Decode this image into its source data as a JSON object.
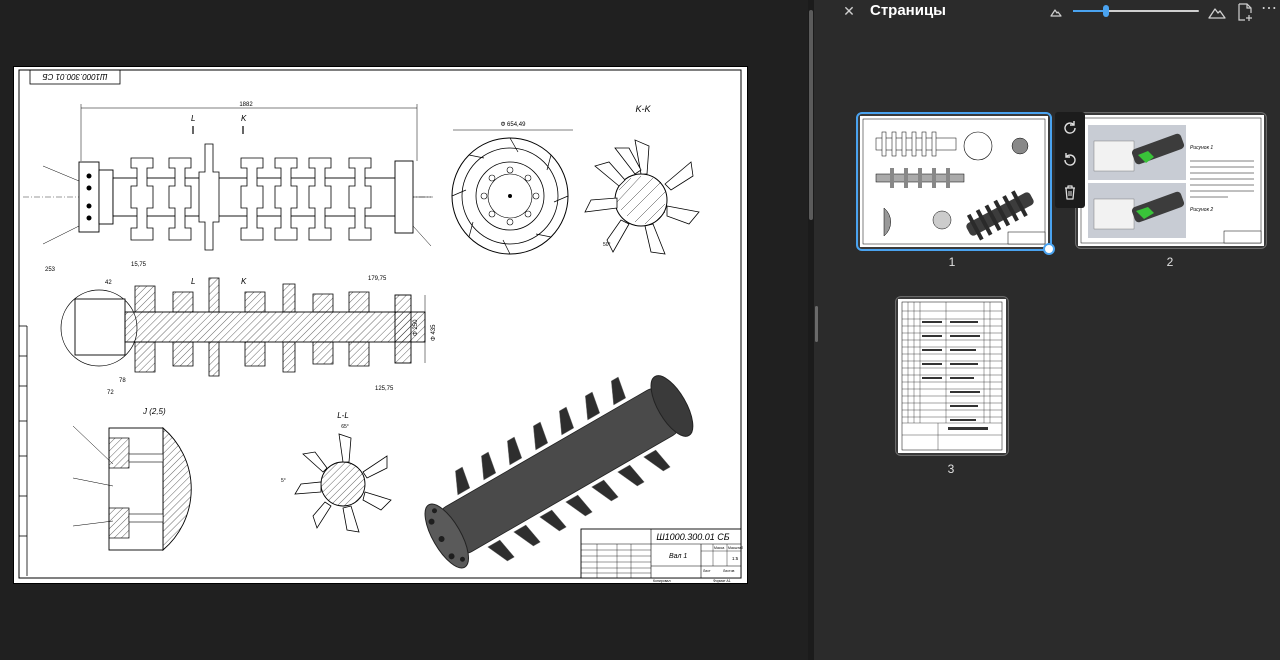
{
  "panel": {
    "title": "Страницы",
    "close_icon": "close-icon",
    "zoom_out_icon": "mountain-small-icon",
    "zoom_in_icon": "mountain-large-icon",
    "insert_icon": "insert-page-icon",
    "more_icon": "more-options-icon",
    "zoom_level": 0.26
  },
  "drawing": {
    "stamp_top": "Ш1000.300.01 СБ",
    "dim_total": "1882",
    "label_l": "L",
    "label_k": "K",
    "section_kk": "K-K",
    "section_ll": "L-L",
    "detail_j": "J (2,5)",
    "diameter": "Φ 654,49",
    "dim_253": "253",
    "dim_42": "42",
    "dim_1575": "15,75",
    "dim_17975": "179,75",
    "dim_12575": "125,75",
    "dim_78": "78",
    "dim_72": "72",
    "dim_d250": "Φ 250",
    "dim_d435": "Φ 435",
    "angle_65": "65°",
    "angle_5": "5°",
    "angle_50": "50°",
    "title_code": "Ш1000.300.01 СБ",
    "title_name": "Вал 1",
    "mass": "Масса",
    "scale": "Масштаб",
    "scale_value": "1:5",
    "sheet": "Лист",
    "sheets": "Листов",
    "format": "Формат А1",
    "copied": "Копировал"
  },
  "pages": [
    {
      "number": "1",
      "selected": true
    },
    {
      "number": "2",
      "selected": false
    },
    {
      "number": "3",
      "selected": false
    }
  ],
  "page2": {
    "fig1": "Рисунок 1",
    "fig2": "Рисунок 2"
  },
  "toolbar": {
    "rotate_right_icon": "rotate-clockwise-icon",
    "rotate_left_icon": "rotate-counterclockwise-icon",
    "delete_icon": "trash-icon"
  }
}
